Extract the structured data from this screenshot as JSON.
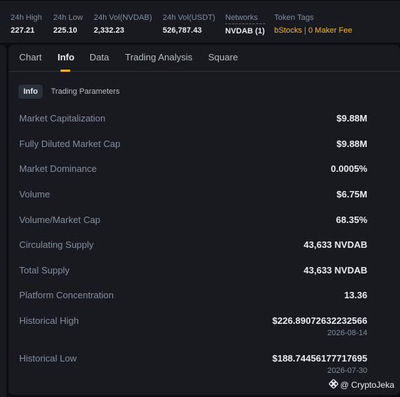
{
  "stats": {
    "high": {
      "label": "24h High",
      "value": "227.21"
    },
    "low": {
      "label": "24h Low",
      "value": "225.10"
    },
    "vol_base": {
      "label": "24h Vol(NVDAB)",
      "value": "2,332.23"
    },
    "vol_quote": {
      "label": "24h Vol(USDT)",
      "value": "526,787.43"
    },
    "networks": {
      "label": "Networks",
      "value": "NVDAB (1)"
    },
    "token_tags": {
      "label": "Token Tags",
      "tags": [
        "bStocks",
        "0 Maker Fee"
      ],
      "separator": "|"
    }
  },
  "tabs": [
    {
      "label": "Chart",
      "active": false
    },
    {
      "label": "Info",
      "active": true
    },
    {
      "label": "Data",
      "active": false
    },
    {
      "label": "Trading Analysis",
      "active": false
    },
    {
      "label": "Square",
      "active": false
    }
  ],
  "subtabs": [
    {
      "label": "Info",
      "active": true
    },
    {
      "label": "Trading Parameters",
      "active": false
    }
  ],
  "info_rows": [
    {
      "label": "Market Capitalization",
      "value": "$9.88M"
    },
    {
      "label": "Fully Diluted Market Cap",
      "value": "$9.88M"
    },
    {
      "label": "Market Dominance",
      "value": "0.0005%"
    },
    {
      "label": "Volume",
      "value": "$6.75M"
    },
    {
      "label": "Volume/Market Cap",
      "value": "68.35%"
    },
    {
      "label": "Circulating Supply",
      "value": "43,633 NVDAB"
    },
    {
      "label": "Total Supply",
      "value": "43,633 NVDAB"
    },
    {
      "label": "Platform Concentration",
      "value": "13.36"
    },
    {
      "label": "Historical High",
      "value": "$226.89072632232566",
      "date": "2026-08-14"
    },
    {
      "label": "Historical Low",
      "value": "$188.74456177717695",
      "date": "2026-07-30"
    }
  ],
  "watermark": {
    "text": "@ CryptoJeka",
    "icon": "binance-diamond-icon"
  },
  "colors": {
    "background": "#0b0e11",
    "panel": "#181a20",
    "accent": "#f0b90b",
    "text_primary": "#eaecef",
    "text_secondary": "#848e9c"
  }
}
